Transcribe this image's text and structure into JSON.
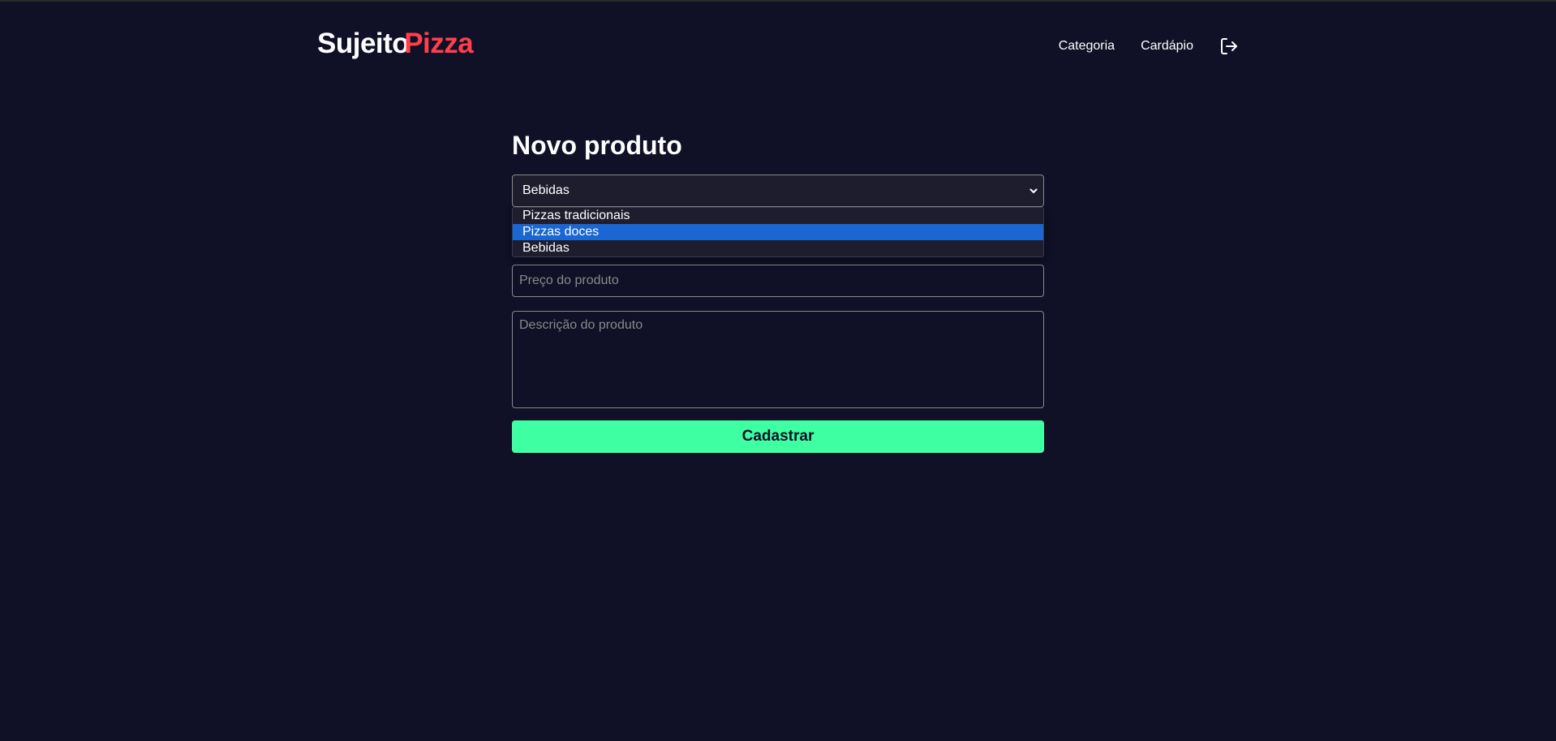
{
  "logo": {
    "part1": "Sujeito",
    "part2": "Pizza"
  },
  "nav": {
    "items": [
      {
        "label": "Categoria"
      },
      {
        "label": "Cardápio"
      }
    ],
    "logout_icon": "logout-icon"
  },
  "page": {
    "title": "Novo produto"
  },
  "category_select": {
    "selected": "Bebidas",
    "options": [
      {
        "label": "Pizzas tradicionais"
      },
      {
        "label": "Pizzas doces"
      },
      {
        "label": "Bebidas"
      }
    ],
    "highlighted_option": "Pizzas doces",
    "chevron_icon": "chevron-down-icon"
  },
  "form": {
    "price_placeholder": "Preço do produto",
    "description_placeholder": "Descrição do produto",
    "submit_label": "Cadastrar"
  },
  "colors": {
    "background": "#101026",
    "brand_red": "#ff3f4b",
    "accent_green": "#3fffa3",
    "option_highlight": "#1a66d2"
  }
}
